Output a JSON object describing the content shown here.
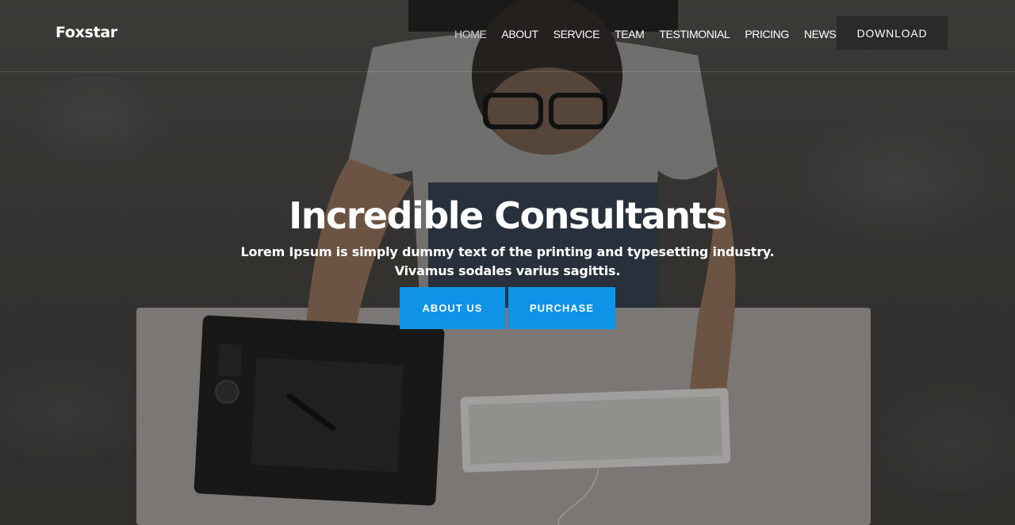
{
  "brand": {
    "name": "Foxstar"
  },
  "nav": {
    "items": [
      {
        "label": "HOME",
        "active": true
      },
      {
        "label": "ABOUT"
      },
      {
        "label": "SERVICE"
      },
      {
        "label": "TEAM"
      },
      {
        "label": "TESTIMONIAL"
      },
      {
        "label": "PRICING"
      },
      {
        "label": "NEWS"
      }
    ],
    "download_label": "DOWNLOAD"
  },
  "hero": {
    "title": "Incredible Consultants",
    "subtitle_line1": "Lorem Ipsum is simply dummy text of the printing and typesetting industry.",
    "subtitle_line2": "Vivamus sodales varius sagittis.",
    "primary_button": "ABOUT US",
    "secondary_button": "PURCHASE"
  },
  "colors": {
    "accent": "#0f93e6",
    "download_bg": "#2a2a2a",
    "text": "#ffffff"
  }
}
